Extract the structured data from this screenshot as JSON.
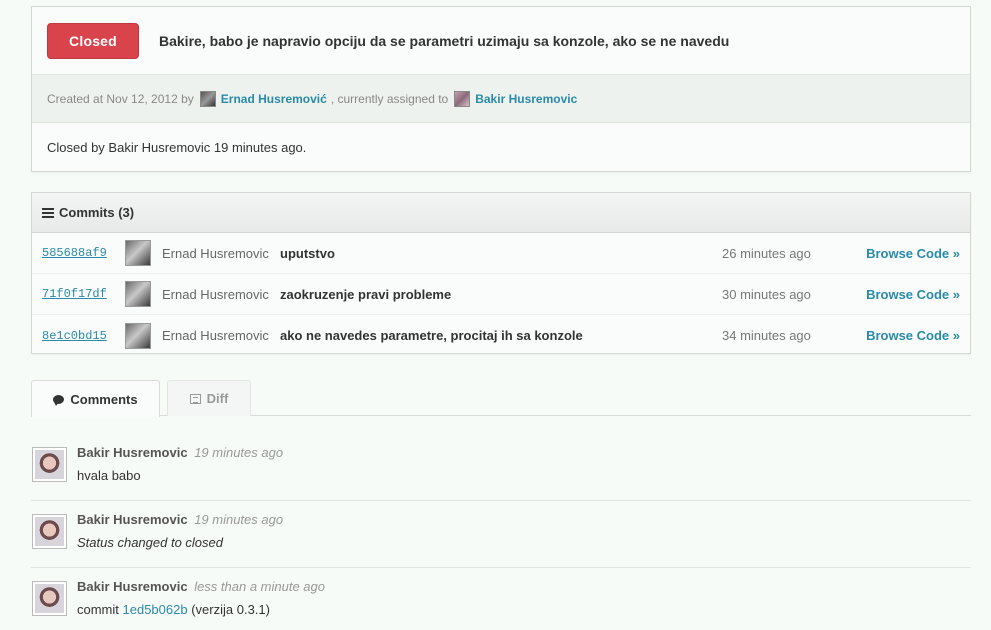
{
  "issue": {
    "status": "Closed",
    "title": "Bakire, babo je napravio opciju da se parametri uzimaju sa konzole, ako se ne navedu",
    "created_prefix": "Created at Nov 12, 2012 by",
    "creator": "Ernad Husremović",
    "assigned_prefix": ", currently assigned to",
    "assignee": "Bakir Husremovic",
    "closed_text": "Closed by Bakir Husremovic 19 minutes ago."
  },
  "commits": {
    "header": "Commits (3)",
    "browse_label": "Browse Code »",
    "items": [
      {
        "sha": "585688af9",
        "author": "Ernad Husremovic",
        "message": "uputstvo",
        "time": "26 minutes ago"
      },
      {
        "sha": "71f0f17df",
        "author": "Ernad Husremovic",
        "message": "zaokruzenje pravi probleme",
        "time": "30 minutes ago"
      },
      {
        "sha": "8e1c0bd15",
        "author": "Ernad Husremovic",
        "message": "ako ne navedes parametre, procitaj ih sa konzole",
        "time": "34 minutes ago"
      }
    ]
  },
  "tabs": [
    {
      "label": "Comments",
      "active": true
    },
    {
      "label": "Diff",
      "active": false
    }
  ],
  "comments": [
    {
      "author": "Bakir Husremovic",
      "time": "19 minutes ago",
      "body": "hvala babo"
    },
    {
      "author": "Bakir Husremovic",
      "time": "19 minutes ago",
      "body": "Status changed to closed"
    },
    {
      "author": "Bakir Husremovic",
      "time": "less than a minute ago",
      "body_prefix": "commit",
      "body_sha": "1ed5b062b",
      "body_suffix": "(verzija 0.3.1)"
    }
  ],
  "colors": {
    "closed_badge": "#d9434b",
    "link": "#2a8aa8"
  }
}
